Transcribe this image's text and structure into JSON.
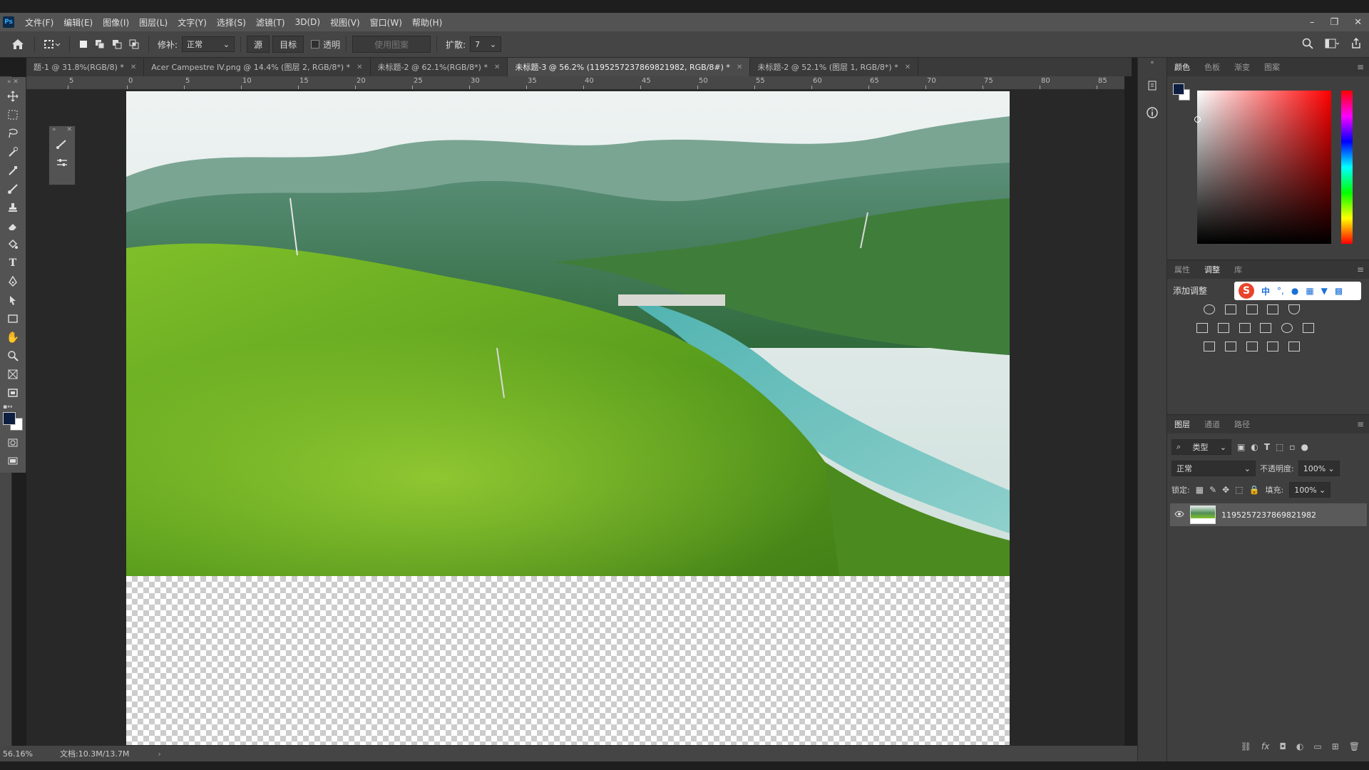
{
  "menubar": {
    "app_icon": "Ps",
    "items": [
      "文件(F)",
      "编辑(E)",
      "图像(I)",
      "图层(L)",
      "文字(Y)",
      "选择(S)",
      "滤镜(T)",
      "3D(D)",
      "视图(V)",
      "窗口(W)",
      "帮助(H)"
    ]
  },
  "options": {
    "mode_label": "修补:",
    "mode_value": "正常",
    "source": "源",
    "target": "目标",
    "transparent": "透明",
    "use_pattern": "使用图案",
    "diffusion_label": "扩散:",
    "diffusion_value": "7"
  },
  "tabs": [
    {
      "label": "题-1 @ 31.8%(RGB/8) *"
    },
    {
      "label": "Acer Campestre IV.png @ 14.4% (图层 2, RGB/8*) *"
    },
    {
      "label": "未标题-2 @ 62.1%(RGB/8*) *"
    },
    {
      "label": "未标题-3 @ 56.2% (1195257237869821982, RGB/8#) *"
    },
    {
      "label": "未标题-2 @ 52.1% (图层 1, RGB/8*) *"
    }
  ],
  "ruler": {
    "h_labels": [
      "5",
      "0",
      "5",
      "10",
      "15",
      "20",
      "25",
      "30",
      "35",
      "40",
      "45",
      "50",
      "55",
      "60",
      "65",
      "70",
      "75",
      "80",
      "85"
    ]
  },
  "status": {
    "zoom": "56.16%",
    "doc_info": "文档:10.3M/13.7M"
  },
  "right_panel": {
    "color_tabs": [
      "颜色",
      "色板",
      "渐变",
      "图案"
    ],
    "adjust_tabs": [
      "属性",
      "调整",
      "库"
    ],
    "add_adjustment": "添加调整",
    "ime_bar": [
      "中",
      "°,"
    ],
    "layers_tabs": [
      "图层",
      "通道",
      "路径"
    ],
    "kind_filter": "类型",
    "blend_mode": "正常",
    "opacity_label": "不透明度:",
    "opacity_value": "100%",
    "lock_label": "锁定:",
    "fill_label": "填充:",
    "fill_value": "100%",
    "layer_name": "1195257237869821982"
  },
  "colors": {
    "foreground": "#0d1e40",
    "background": "#ffffff",
    "accent": "#31a8ff"
  }
}
